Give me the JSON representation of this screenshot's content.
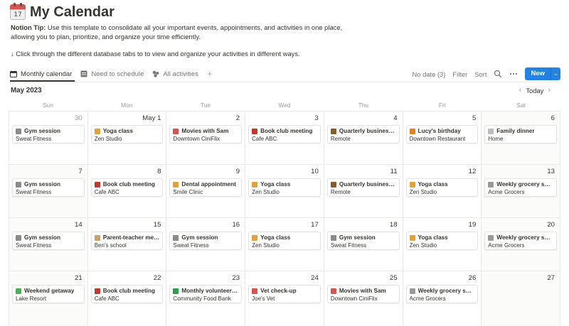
{
  "page": {
    "title": "My Calendar",
    "icon": "calendar-icon",
    "icon_date": "17",
    "tip_label": "Notion Tip:",
    "tip_text": " Use this template to consolidate all your important events, appointments, and activities in one place, allowing you to plan, prioritize, and organize your time efficiently.",
    "hint": "↓ Click through the different database tabs to to view and organize your activities in different ways."
  },
  "tabs": [
    {
      "label": "Monthly calendar",
      "icon": "calendar-view-icon",
      "active": true
    },
    {
      "label": "Need to schedule",
      "icon": "table-view-icon",
      "active": false
    },
    {
      "label": "All activities",
      "icon": "gallery-view-icon",
      "active": false
    }
  ],
  "toolbar": {
    "no_date": "No date (3)",
    "filter": "Filter",
    "sort": "Sort",
    "search_icon": "search-icon",
    "more_icon": "more-icon",
    "new_label": "New",
    "new_caret": "⌄",
    "accent": "#2383e2"
  },
  "calendar": {
    "month_label": "May 2023",
    "today_label": "Today",
    "prev": "‹",
    "next": "›",
    "weekdays": [
      "Sun",
      "Mon",
      "Tue",
      "Wed",
      "Thu",
      "Fri",
      "Sat"
    ],
    "weeks": [
      [
        {
          "day": "30",
          "muted": true,
          "event": {
            "title": "Gym session",
            "location": "Sweat Fitness",
            "icon": "dumbbell-icon",
            "color": "#8a8a8a"
          }
        },
        {
          "day": "May 1",
          "event": {
            "title": "Yoga class",
            "location": "Zen Studio",
            "icon": "yoga-icon",
            "color": "#e0a23a"
          }
        },
        {
          "day": "2",
          "event": {
            "title": "Movies with Sam",
            "location": "Downtown CiniFlix",
            "icon": "popcorn-icon",
            "color": "#d9534f"
          }
        },
        {
          "day": "3",
          "event": {
            "title": "Book club meeting",
            "location": "Cafe ABC",
            "icon": "book-icon",
            "color": "#c0392b"
          }
        },
        {
          "day": "4",
          "event": {
            "title": "Quarterly business re...",
            "location": "Remote",
            "icon": "briefcase-icon",
            "color": "#8b5a2b"
          }
        },
        {
          "day": "5",
          "event": {
            "title": "Lucy's birthday",
            "location": "Downtown Restaurant",
            "icon": "gift-icon",
            "color": "#e67e22"
          }
        },
        {
          "day": "6",
          "weekend": true,
          "event": {
            "title": "Family dinner",
            "location": "Home",
            "icon": "dinner-icon",
            "color": "#bdbdbd"
          }
        }
      ],
      [
        {
          "day": "7",
          "weekend": true,
          "event": {
            "title": "Gym session",
            "location": "Sweat Fitness",
            "icon": "dumbbell-icon",
            "color": "#8a8a8a"
          }
        },
        {
          "day": "8",
          "event": {
            "title": "Book club meeting",
            "location": "Cafe ABC",
            "icon": "book-icon",
            "color": "#c0392b"
          }
        },
        {
          "day": "9",
          "event": {
            "title": "Dental appointment",
            "location": "Smile Clinic",
            "icon": "tooth-icon",
            "color": "#e0a23a"
          }
        },
        {
          "day": "10",
          "event": {
            "title": "Yoga class",
            "location": "Zen Studio",
            "icon": "yoga-icon",
            "color": "#e0a23a"
          }
        },
        {
          "day": "11",
          "event": {
            "title": "Quarterly business re...",
            "location": "Remote",
            "icon": "briefcase-icon",
            "color": "#8b5a2b"
          }
        },
        {
          "day": "12",
          "event": {
            "title": "Yoga class",
            "location": "Zen Studio",
            "icon": "yoga-icon",
            "color": "#e0a23a"
          }
        },
        {
          "day": "13",
          "weekend": true,
          "event": {
            "title": "Weekly grocery shop...",
            "location": "Acme Grocers",
            "icon": "cart-icon",
            "color": "#9b9a97"
          }
        }
      ],
      [
        {
          "day": "14",
          "weekend": true,
          "event": {
            "title": "Gym session",
            "location": "Sweat Fitness",
            "icon": "dumbbell-icon",
            "color": "#8a8a8a"
          }
        },
        {
          "day": "15",
          "event": {
            "title": "Parent-teacher meeti...",
            "location": "Ben's school",
            "icon": "notebook-icon",
            "color": "#c8a26b"
          }
        },
        {
          "day": "16",
          "event": {
            "title": "Gym session",
            "location": "Sweat Fitness",
            "icon": "dumbbell-icon",
            "color": "#8a8a8a"
          }
        },
        {
          "day": "17",
          "event": {
            "title": "Yoga class",
            "location": "Zen Studio",
            "icon": "yoga-icon",
            "color": "#e0a23a"
          }
        },
        {
          "day": "18",
          "event": {
            "title": "Gym session",
            "location": "Sweat Fitness",
            "icon": "dumbbell-icon",
            "color": "#8a8a8a"
          }
        },
        {
          "day": "19",
          "event": {
            "title": "Yoga class",
            "location": "Zen Studio",
            "icon": "yoga-icon",
            "color": "#e0a23a"
          }
        },
        {
          "day": "20",
          "weekend": true,
          "event": {
            "title": "Weekly grocery shop...",
            "location": "Acme Grocers",
            "icon": "cart-icon",
            "color": "#9b9a97"
          }
        }
      ],
      [
        {
          "day": "21",
          "weekend": true,
          "event": {
            "title": "Weekend getaway",
            "location": "Lake Resort",
            "icon": "palm-tree-icon",
            "color": "#4caf50"
          }
        },
        {
          "day": "22",
          "event": {
            "title": "Book club meeting",
            "location": "Cafe ABC",
            "icon": "book-icon",
            "color": "#c0392b"
          }
        },
        {
          "day": "23",
          "event": {
            "title": "Monthly volunteer work",
            "location": "Community Food Bank",
            "icon": "recycle-icon",
            "color": "#2e9e4f"
          }
        },
        {
          "day": "24",
          "event": {
            "title": "Vet check-up",
            "location": "Joe's Vet",
            "icon": "paw-icon",
            "color": "#d9534f"
          }
        },
        {
          "day": "25",
          "event": {
            "title": "Movies with Sam",
            "location": "Downtown CiniFlix",
            "icon": "popcorn-icon",
            "color": "#d9534f"
          }
        },
        {
          "day": "26",
          "event": {
            "title": "Weekly grocery shop...",
            "location": "Acme Grocers",
            "icon": "cart-icon",
            "color": "#9b9a97"
          }
        },
        {
          "day": "27",
          "weekend": true
        }
      ]
    ]
  }
}
